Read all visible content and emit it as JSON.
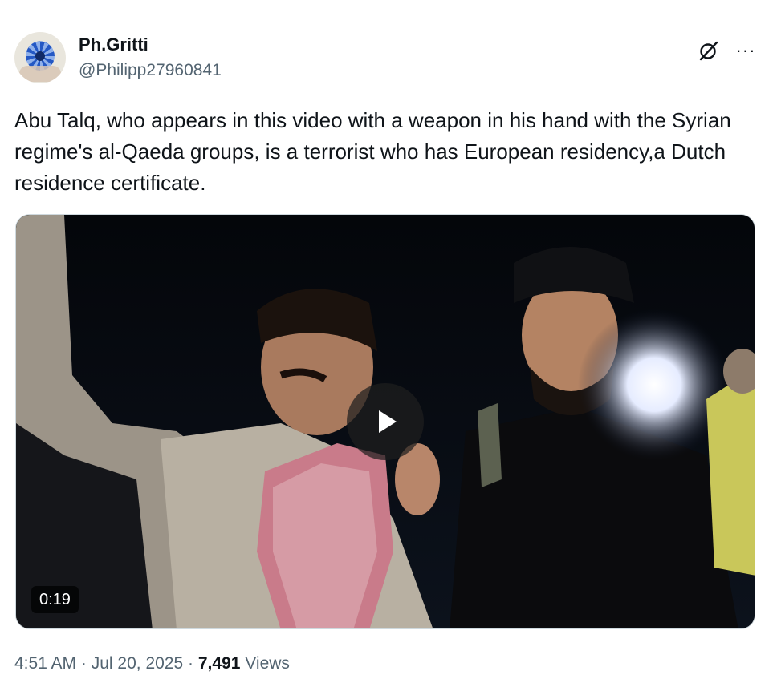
{
  "author": {
    "display_name": "Ph.Gritti",
    "handle": "@Philipp27960841",
    "avatar_icon": "flower-avatar"
  },
  "header_icons": {
    "grok": "grok-icon",
    "more": "more-options-icon",
    "more_glyph": "···"
  },
  "tweet": {
    "text": "Abu Talq, who appears in this video with a weapon in his hand with the Syrian regime's al-Qaeda groups, is a terrorist who has European residency,a Dutch residence certificate."
  },
  "media": {
    "type": "video",
    "duration": "0:19",
    "play_icon": "play-icon"
  },
  "meta": {
    "time": "4:51 AM",
    "separator": "·",
    "date": "Jul 20, 2025",
    "views_count": "7,491",
    "views_label": "Views"
  },
  "colors": {
    "text_primary": "#0f1419",
    "text_secondary": "#536471",
    "border": "#cfd9de"
  }
}
